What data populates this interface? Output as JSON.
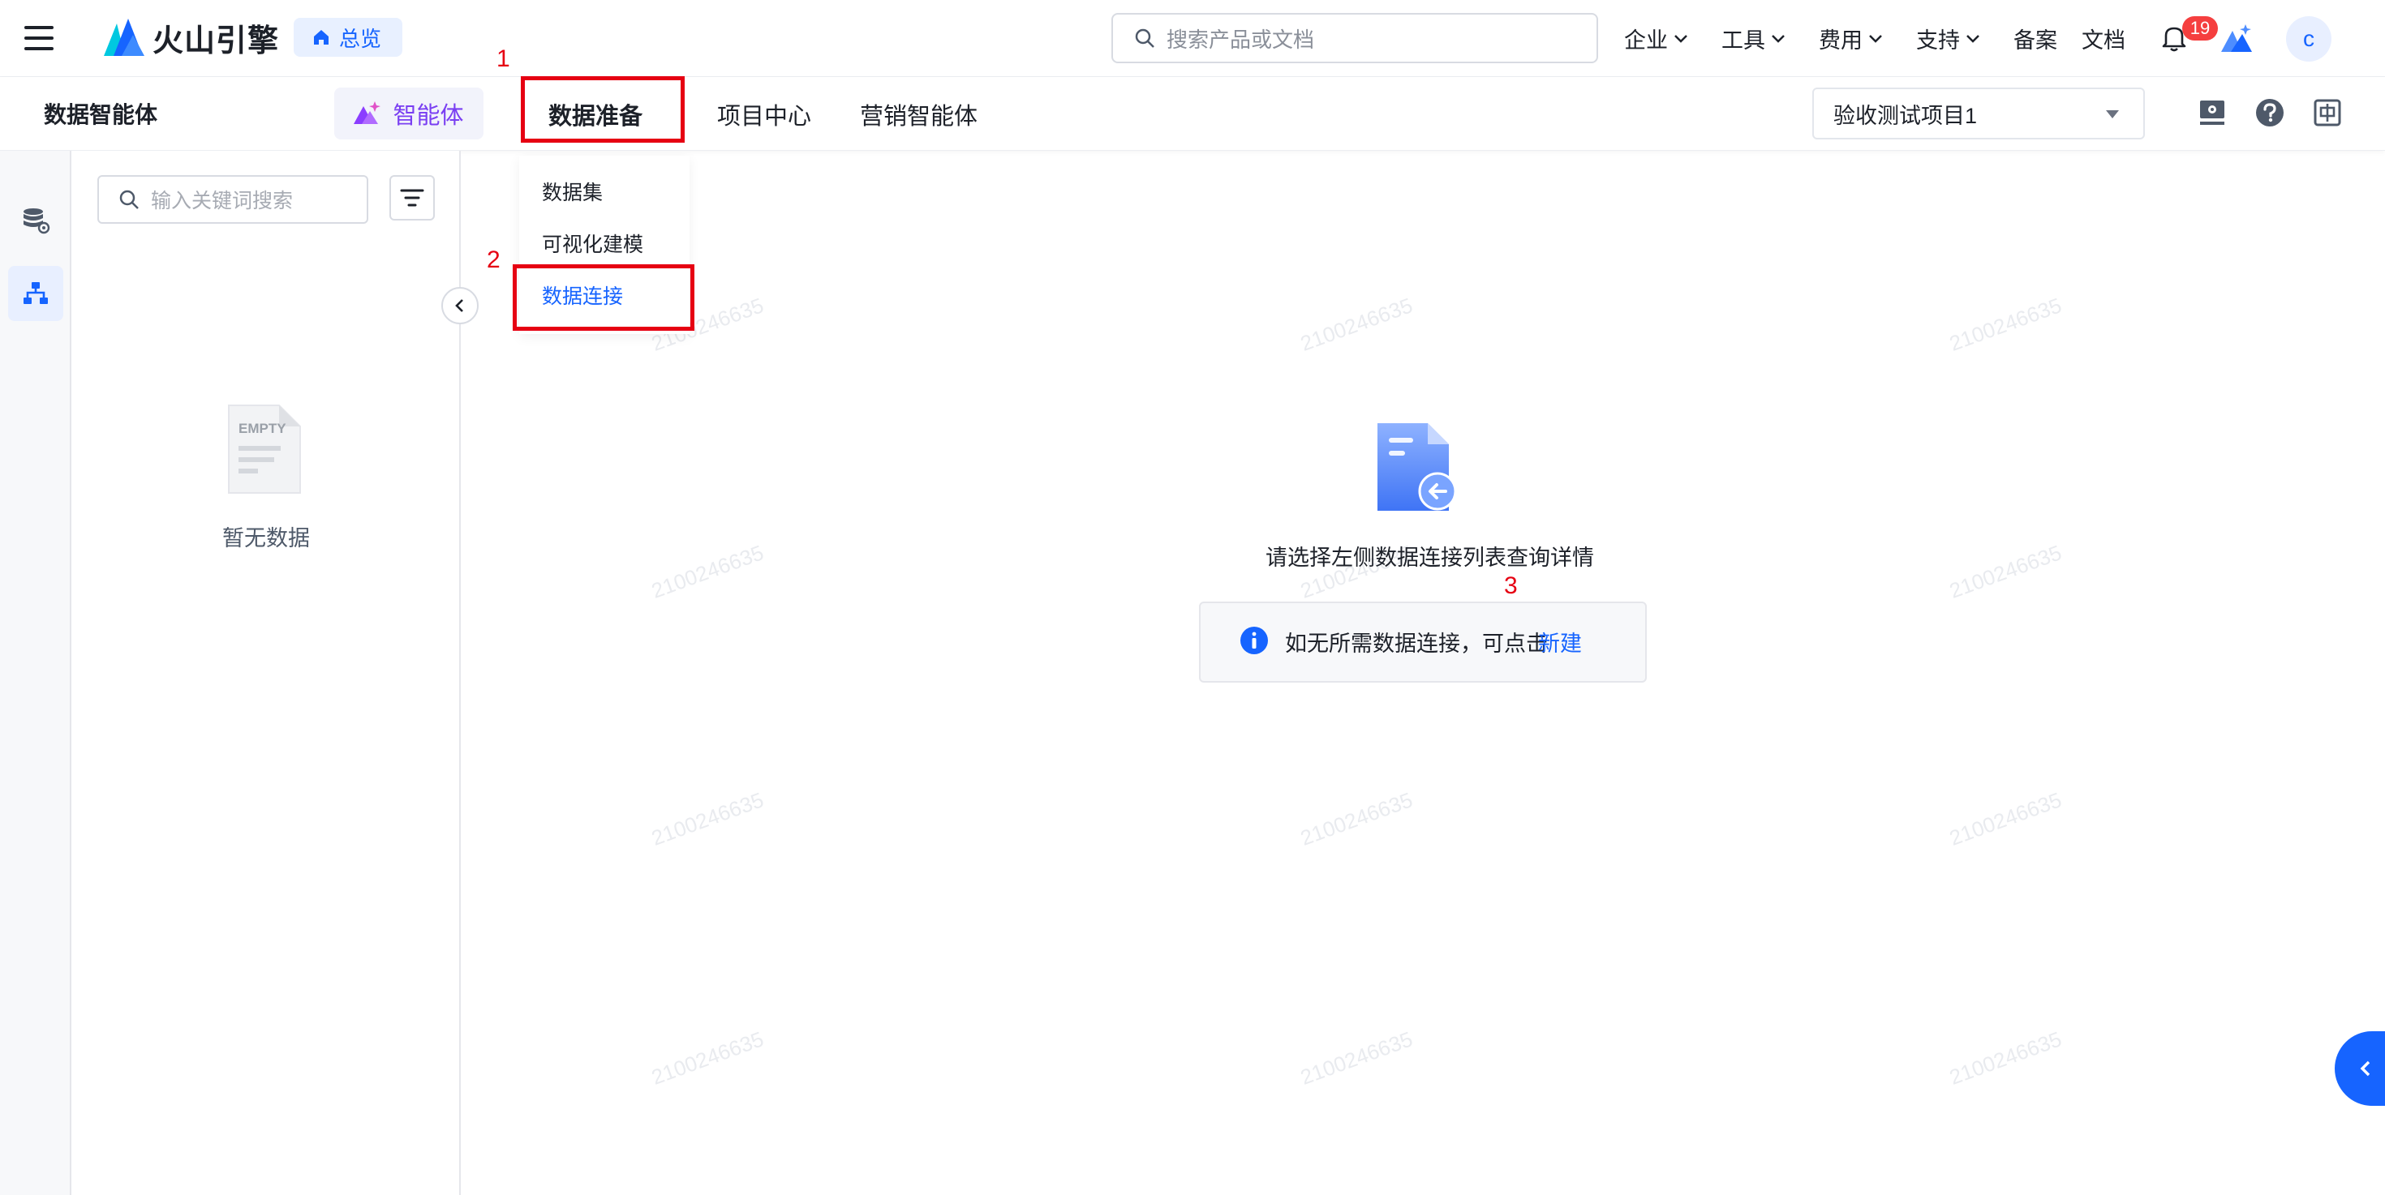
{
  "brand": {
    "name": "火山引擎"
  },
  "header": {
    "overview": "总览",
    "search_placeholder": "搜索产品或文档",
    "nav": [
      "企业",
      "工具",
      "费用",
      "支持",
      "备案",
      "文档"
    ],
    "notification_count": "19",
    "avatar_letter": "c"
  },
  "subheader": {
    "app_title": "数据智能体",
    "tabs": [
      "智能体",
      "数据准备",
      "项目中心",
      "营销智能体"
    ],
    "active_tab": "数据准备",
    "project": "验收测试项目1"
  },
  "dropdown": {
    "items": [
      "数据集",
      "可视化建模",
      "数据连接"
    ],
    "active": "数据连接"
  },
  "list_panel": {
    "search_placeholder": "输入关键词搜索",
    "empty_label": "EMPTY",
    "empty_text": "暂无数据"
  },
  "main": {
    "detail_message": "请选择左侧数据连接列表查询详情",
    "tip_text": "如无所需数据连接，可点击",
    "tip_link": "新建"
  },
  "annotations": [
    "1",
    "2",
    "3"
  ],
  "watermark": "2100246635",
  "colors": {
    "primary": "#1664ff",
    "annotation": "#e60012",
    "agent": "#7a3ff2",
    "badge": "#f53f3f"
  }
}
